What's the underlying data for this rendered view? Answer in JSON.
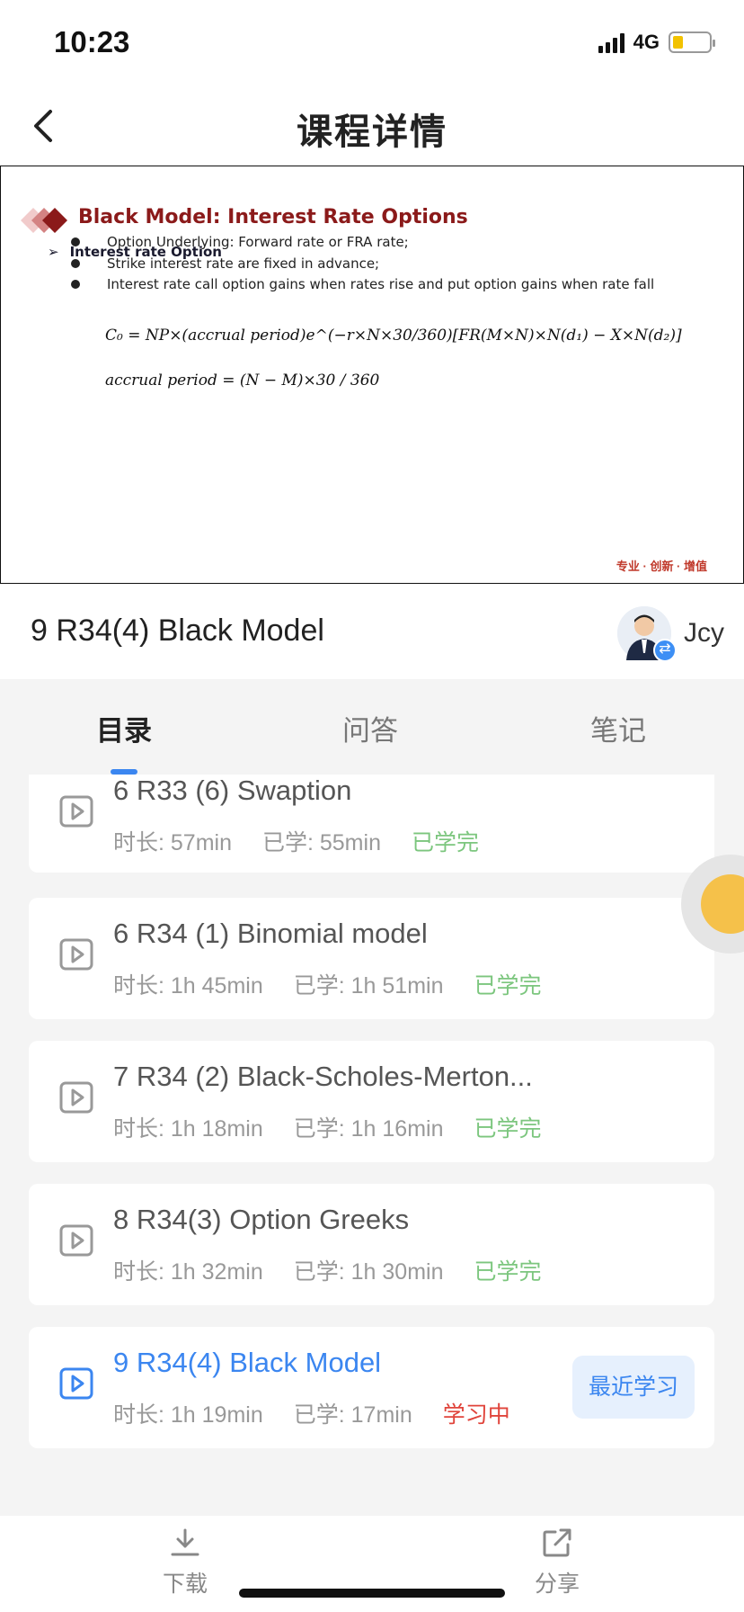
{
  "status_bar": {
    "time": "10:23",
    "network": "4G",
    "battery_level": 0.2
  },
  "header": {
    "title": "课程详情"
  },
  "slide": {
    "title": "Black Model: Interest Rate Options",
    "subtitle": "Interest rate Option",
    "bullets": [
      "Option Underlying: Forward rate or FRA rate;",
      "Strike interest rate are fixed in advance;",
      "Interest rate call option gains when rates rise and put option gains when rate fall"
    ],
    "formula_1": "C₀ = NP×(accrual period)e^(−r×N×30/360)[FR(M×N)×N(d₁) − X×N(d₂)]",
    "formula_2": "accrual period = (N − M)×30 / 360",
    "brand": "专业 · 创新 · 增值"
  },
  "lesson": {
    "title": "9 R34(4) Black Model",
    "teacher_name": "Jcy"
  },
  "tabs": [
    {
      "label": "目录",
      "active": true
    },
    {
      "label": "问答",
      "active": false
    },
    {
      "label": "笔记",
      "active": false
    }
  ],
  "chapters": [
    {
      "title": "6 R33 (6) Swaption",
      "duration": "时长: 57min",
      "studied": "已学: 55min",
      "status": "已学完"
    },
    {
      "title": "6 R34 (1) Binomial model",
      "duration": "时长: 1h 45min",
      "studied": "已学: 1h 51min",
      "status": "已学完"
    },
    {
      "title": "7 R34 (2) Black-Scholes-Merton...",
      "duration": "时长: 1h 18min",
      "studied": "已学: 1h 16min",
      "status": "已学完"
    },
    {
      "title": "8 R34(3) Option Greeks",
      "duration": "时长: 1h 32min",
      "studied": "已学: 1h 30min",
      "status": "已学完"
    },
    {
      "title": "9 R34(4) Black Model",
      "duration": "时长: 1h 19min",
      "studied": "已学: 17min",
      "status": "学习中",
      "action": "最近学习"
    }
  ],
  "bottom_bar": {
    "download_label": "下载",
    "share_label": "分享"
  },
  "colors": {
    "accent": "#3b86f0",
    "done": "#7cc67e",
    "studying": "#e0443b",
    "slide_title": "#8b1a1a"
  }
}
